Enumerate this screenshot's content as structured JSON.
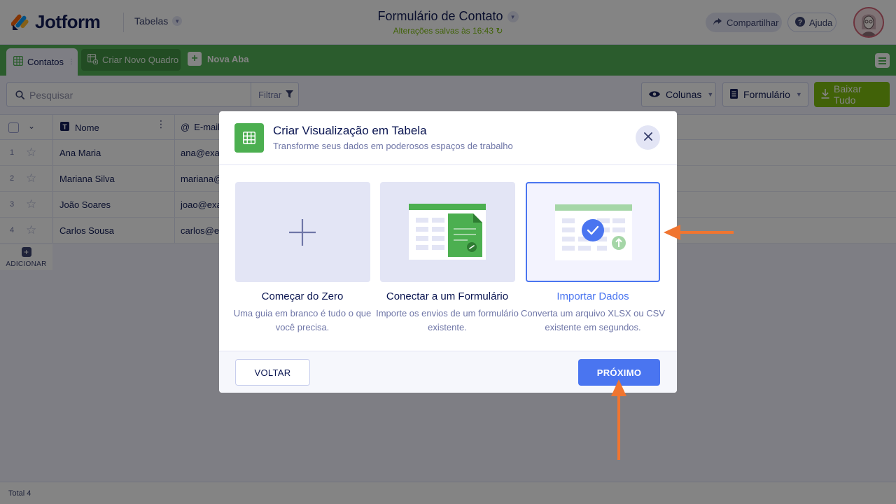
{
  "header": {
    "brand": "Jotform",
    "section": "Tabelas",
    "form_title": "Formulário de Contato",
    "saved_status": "Alterações salvas às 16:43",
    "share_label": "Compartilhar",
    "help_label": "Ajuda"
  },
  "tabs": {
    "active_label": "Contatos",
    "create_label": "Criar Novo Quadro",
    "new_tab_label": "Nova Aba"
  },
  "toolbar": {
    "search_placeholder": "Pesquisar",
    "filter_label": "Filtrar",
    "columns_label": "Colunas",
    "form_label": "Formulário",
    "download_label": "Baixar Tudo"
  },
  "table": {
    "columns": [
      "Nome",
      "E-mail"
    ],
    "rows": [
      {
        "num": "1",
        "name": "Ana Maria",
        "email": "ana@exan"
      },
      {
        "num": "2",
        "name": "Mariana Silva",
        "email": "mariana@"
      },
      {
        "num": "3",
        "name": "João Soares",
        "email": "joao@exar"
      },
      {
        "num": "4",
        "name": "Carlos Sousa",
        "email": "carlos@ex"
      }
    ],
    "add_label": "ADICIONAR",
    "total_label": "Total 4"
  },
  "modal": {
    "title": "Criar Visualização em Tabela",
    "subtitle": "Transforme seus dados em poderosos espaços de trabalho",
    "options": [
      {
        "title": "Começar do Zero",
        "desc": "Uma guia em branco é tudo o que você precisa."
      },
      {
        "title": "Conectar a um Formulário",
        "desc": "Importe os envios de um formulário existente."
      },
      {
        "title": "Importar Dados",
        "desc": "Converta um arquivo XLSX ou CSV existente em segundos."
      }
    ],
    "selected_option": "Importar Dados",
    "back_label": "VOLTAR",
    "next_label": "PRÓXIMO"
  },
  "colors": {
    "brand_green": "#4caf50",
    "accent_blue": "#4a75f0",
    "download_green": "#78bb07",
    "annotation_orange": "#f07530"
  }
}
